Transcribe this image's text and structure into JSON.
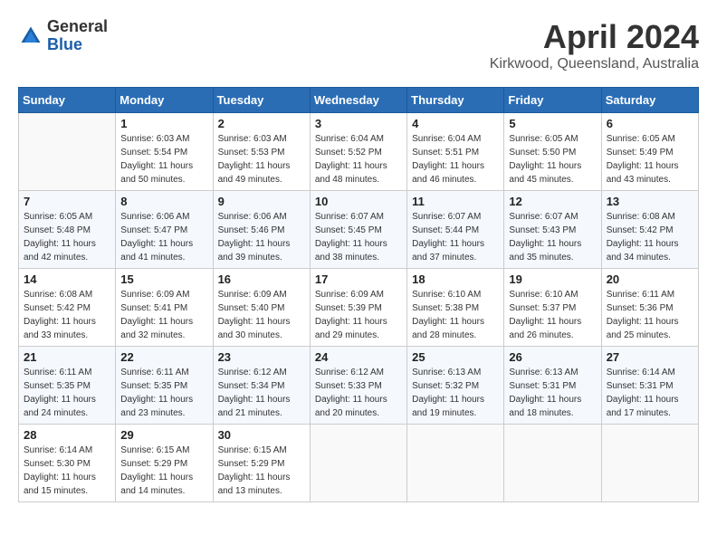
{
  "header": {
    "logo_general": "General",
    "logo_blue": "Blue",
    "title": "April 2024",
    "subtitle": "Kirkwood, Queensland, Australia"
  },
  "days_of_week": [
    "Sunday",
    "Monday",
    "Tuesday",
    "Wednesday",
    "Thursday",
    "Friday",
    "Saturday"
  ],
  "weeks": [
    [
      {
        "day": "",
        "sunrise": "",
        "sunset": "",
        "daylight": ""
      },
      {
        "day": "1",
        "sunrise": "Sunrise: 6:03 AM",
        "sunset": "Sunset: 5:54 PM",
        "daylight": "Daylight: 11 hours and 50 minutes."
      },
      {
        "day": "2",
        "sunrise": "Sunrise: 6:03 AM",
        "sunset": "Sunset: 5:53 PM",
        "daylight": "Daylight: 11 hours and 49 minutes."
      },
      {
        "day": "3",
        "sunrise": "Sunrise: 6:04 AM",
        "sunset": "Sunset: 5:52 PM",
        "daylight": "Daylight: 11 hours and 48 minutes."
      },
      {
        "day": "4",
        "sunrise": "Sunrise: 6:04 AM",
        "sunset": "Sunset: 5:51 PM",
        "daylight": "Daylight: 11 hours and 46 minutes."
      },
      {
        "day": "5",
        "sunrise": "Sunrise: 6:05 AM",
        "sunset": "Sunset: 5:50 PM",
        "daylight": "Daylight: 11 hours and 45 minutes."
      },
      {
        "day": "6",
        "sunrise": "Sunrise: 6:05 AM",
        "sunset": "Sunset: 5:49 PM",
        "daylight": "Daylight: 11 hours and 43 minutes."
      }
    ],
    [
      {
        "day": "7",
        "sunrise": "Sunrise: 6:05 AM",
        "sunset": "Sunset: 5:48 PM",
        "daylight": "Daylight: 11 hours and 42 minutes."
      },
      {
        "day": "8",
        "sunrise": "Sunrise: 6:06 AM",
        "sunset": "Sunset: 5:47 PM",
        "daylight": "Daylight: 11 hours and 41 minutes."
      },
      {
        "day": "9",
        "sunrise": "Sunrise: 6:06 AM",
        "sunset": "Sunset: 5:46 PM",
        "daylight": "Daylight: 11 hours and 39 minutes."
      },
      {
        "day": "10",
        "sunrise": "Sunrise: 6:07 AM",
        "sunset": "Sunset: 5:45 PM",
        "daylight": "Daylight: 11 hours and 38 minutes."
      },
      {
        "day": "11",
        "sunrise": "Sunrise: 6:07 AM",
        "sunset": "Sunset: 5:44 PM",
        "daylight": "Daylight: 11 hours and 37 minutes."
      },
      {
        "day": "12",
        "sunrise": "Sunrise: 6:07 AM",
        "sunset": "Sunset: 5:43 PM",
        "daylight": "Daylight: 11 hours and 35 minutes."
      },
      {
        "day": "13",
        "sunrise": "Sunrise: 6:08 AM",
        "sunset": "Sunset: 5:42 PM",
        "daylight": "Daylight: 11 hours and 34 minutes."
      }
    ],
    [
      {
        "day": "14",
        "sunrise": "Sunrise: 6:08 AM",
        "sunset": "Sunset: 5:42 PM",
        "daylight": "Daylight: 11 hours and 33 minutes."
      },
      {
        "day": "15",
        "sunrise": "Sunrise: 6:09 AM",
        "sunset": "Sunset: 5:41 PM",
        "daylight": "Daylight: 11 hours and 32 minutes."
      },
      {
        "day": "16",
        "sunrise": "Sunrise: 6:09 AM",
        "sunset": "Sunset: 5:40 PM",
        "daylight": "Daylight: 11 hours and 30 minutes."
      },
      {
        "day": "17",
        "sunrise": "Sunrise: 6:09 AM",
        "sunset": "Sunset: 5:39 PM",
        "daylight": "Daylight: 11 hours and 29 minutes."
      },
      {
        "day": "18",
        "sunrise": "Sunrise: 6:10 AM",
        "sunset": "Sunset: 5:38 PM",
        "daylight": "Daylight: 11 hours and 28 minutes."
      },
      {
        "day": "19",
        "sunrise": "Sunrise: 6:10 AM",
        "sunset": "Sunset: 5:37 PM",
        "daylight": "Daylight: 11 hours and 26 minutes."
      },
      {
        "day": "20",
        "sunrise": "Sunrise: 6:11 AM",
        "sunset": "Sunset: 5:36 PM",
        "daylight": "Daylight: 11 hours and 25 minutes."
      }
    ],
    [
      {
        "day": "21",
        "sunrise": "Sunrise: 6:11 AM",
        "sunset": "Sunset: 5:35 PM",
        "daylight": "Daylight: 11 hours and 24 minutes."
      },
      {
        "day": "22",
        "sunrise": "Sunrise: 6:11 AM",
        "sunset": "Sunset: 5:35 PM",
        "daylight": "Daylight: 11 hours and 23 minutes."
      },
      {
        "day": "23",
        "sunrise": "Sunrise: 6:12 AM",
        "sunset": "Sunset: 5:34 PM",
        "daylight": "Daylight: 11 hours and 21 minutes."
      },
      {
        "day": "24",
        "sunrise": "Sunrise: 6:12 AM",
        "sunset": "Sunset: 5:33 PM",
        "daylight": "Daylight: 11 hours and 20 minutes."
      },
      {
        "day": "25",
        "sunrise": "Sunrise: 6:13 AM",
        "sunset": "Sunset: 5:32 PM",
        "daylight": "Daylight: 11 hours and 19 minutes."
      },
      {
        "day": "26",
        "sunrise": "Sunrise: 6:13 AM",
        "sunset": "Sunset: 5:31 PM",
        "daylight": "Daylight: 11 hours and 18 minutes."
      },
      {
        "day": "27",
        "sunrise": "Sunrise: 6:14 AM",
        "sunset": "Sunset: 5:31 PM",
        "daylight": "Daylight: 11 hours and 17 minutes."
      }
    ],
    [
      {
        "day": "28",
        "sunrise": "Sunrise: 6:14 AM",
        "sunset": "Sunset: 5:30 PM",
        "daylight": "Daylight: 11 hours and 15 minutes."
      },
      {
        "day": "29",
        "sunrise": "Sunrise: 6:15 AM",
        "sunset": "Sunset: 5:29 PM",
        "daylight": "Daylight: 11 hours and 14 minutes."
      },
      {
        "day": "30",
        "sunrise": "Sunrise: 6:15 AM",
        "sunset": "Sunset: 5:29 PM",
        "daylight": "Daylight: 11 hours and 13 minutes."
      },
      {
        "day": "",
        "sunrise": "",
        "sunset": "",
        "daylight": ""
      },
      {
        "day": "",
        "sunrise": "",
        "sunset": "",
        "daylight": ""
      },
      {
        "day": "",
        "sunrise": "",
        "sunset": "",
        "daylight": ""
      },
      {
        "day": "",
        "sunrise": "",
        "sunset": "",
        "daylight": ""
      }
    ]
  ]
}
